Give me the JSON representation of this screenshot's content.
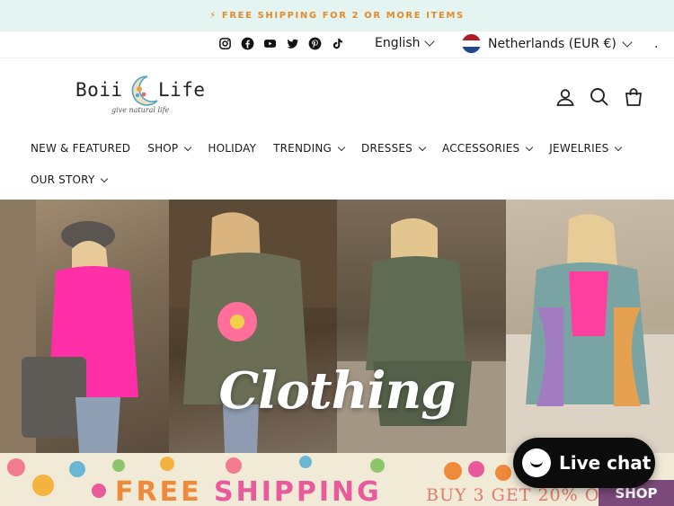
{
  "announcement": {
    "text": "⚡ FREE SHIPPING FOR 2 OR MORE ITEMS"
  },
  "utility": {
    "socials": [
      "instagram-icon",
      "facebook-icon",
      "youtube-icon",
      "twitter-icon",
      "pinterest-icon",
      "tiktok-icon"
    ],
    "language": "English",
    "currency": "Netherlands (EUR €)",
    "more": "."
  },
  "header": {
    "logo_text": "Boii   Life",
    "logo_tagline": "give natural life",
    "icons": [
      "account-icon",
      "search-icon",
      "cart-icon"
    ]
  },
  "nav": {
    "row1": [
      {
        "label": "NEW & FEATURED",
        "dropdown": false
      },
      {
        "label": "SHOP",
        "dropdown": true
      },
      {
        "label": "HOLIDAY",
        "dropdown": false
      },
      {
        "label": "TRENDING",
        "dropdown": true
      },
      {
        "label": "DRESSES",
        "dropdown": true
      },
      {
        "label": "ACCESSORIES",
        "dropdown": true
      },
      {
        "label": "JEWELRIES",
        "dropdown": true
      }
    ],
    "row2": [
      {
        "label": "OUR STORY",
        "dropdown": true
      }
    ]
  },
  "hero": {
    "title": "Clothing"
  },
  "promo": {
    "free": "FREE",
    "shipping": "SHIPPING",
    "buy": "BUY 3 GET 20% OFF",
    "shop": "SHOP"
  },
  "chat": {
    "label": "Live chat"
  },
  "colors": {
    "announce_bg": "#e4f4f1",
    "announce_text": "#e38b2c",
    "chat_bg": "#0c0c0c"
  }
}
